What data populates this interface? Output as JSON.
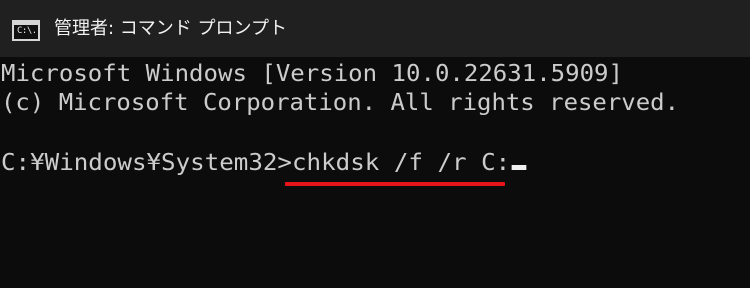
{
  "window": {
    "title": "管理者: コマンド プロンプト",
    "icon": "cmd-icon",
    "icon_text": "C:\\."
  },
  "console": {
    "line1": "Microsoft Windows [Version 10.0.22631.5909]",
    "line2": "(c) Microsoft Corporation. All rights reserved.",
    "prompt": "C:¥Windows¥System32>",
    "command": "chkdsk /f /r C:"
  },
  "colors": {
    "console_bg": "#0c0c0c",
    "titlebar_bg": "#202020",
    "text": "#cccccc",
    "highlight_underline": "#e8141b"
  }
}
